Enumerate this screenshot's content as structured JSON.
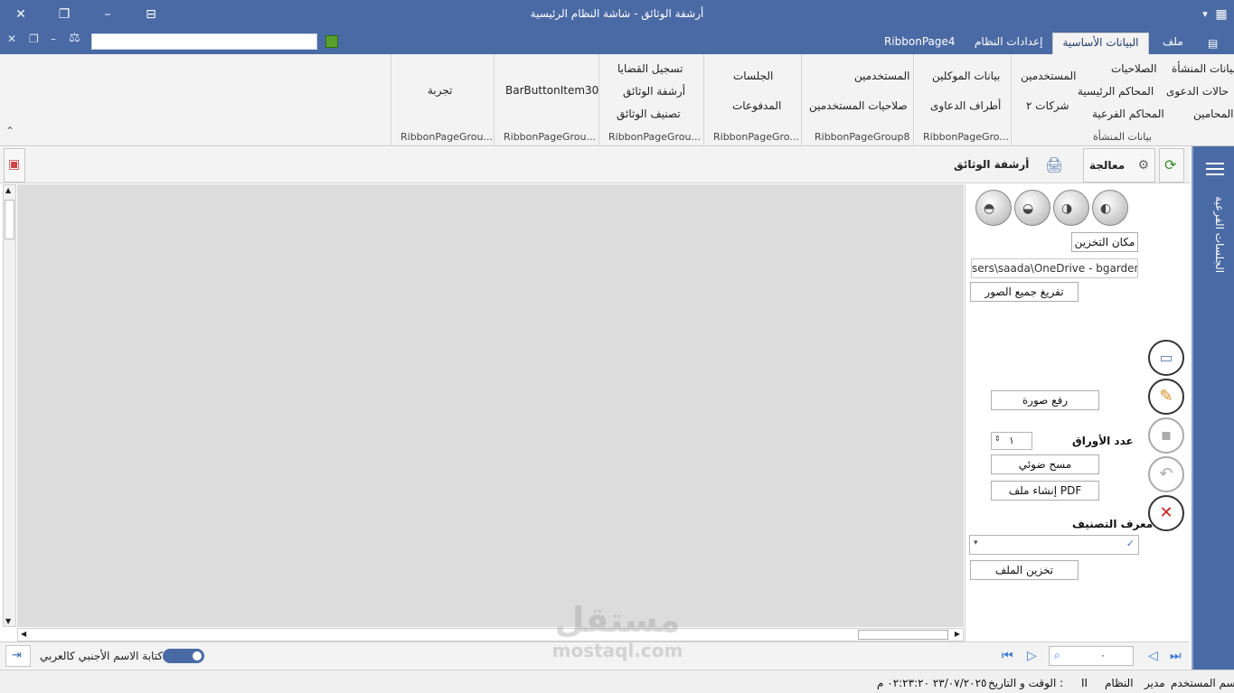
{
  "window": {
    "title": "أرشفة الوثائق - شاشة النظام الرئيسية"
  },
  "tabs": [
    {
      "label": "ملف"
    },
    {
      "label": "البيانات الأساسية"
    },
    {
      "label": "إعدادات النظام"
    },
    {
      "label": "RibbonPage4"
    }
  ],
  "ribbon": {
    "group1": {
      "items": [
        "بيانات المنشأة",
        "الصلاحيات",
        "المستخدمين",
        "حالات الدعوى",
        "المحاكم الرئيسية",
        "شركات ٢",
        "المحامين",
        "المحاكم الفرعية"
      ],
      "name": "بيانات المنشأة"
    },
    "group2": {
      "items": [
        "بيانات الموكلين",
        "أطراف الدعاوى"
      ],
      "name": "RibbonPageGro..."
    },
    "group3": {
      "items": [
        "المستخدمين",
        "صلاحيات المستخدمين"
      ],
      "name": "RibbonPageGroup8"
    },
    "group4": {
      "items": [
        "الجلسات",
        "المدفوعات"
      ],
      "name": "RibbonPageGro..."
    },
    "group5": {
      "items": [
        "تسجيل القضايا",
        "أرشفة الوثائق",
        "تصنيف الوثائق"
      ],
      "name": "RibbonPageGrou..."
    },
    "group6": {
      "items": [
        "BarButtonItem30"
      ],
      "name": "RibbonPageGrou..."
    },
    "group7": {
      "items": [
        "تجربة"
      ],
      "name": "RibbonPageGrou..."
    }
  },
  "side": {
    "label": "الجلسات الفرعية"
  },
  "toolbar": {
    "treat": "معالجة",
    "archive": "أرشفة الوثائق"
  },
  "panel": {
    "storage_location": "مكان التخزين",
    "path": "sers\\saada\\OneDrive - bgardens",
    "clear_all": "تفريغ جميع الصور",
    "upload_image": "رفع صورة",
    "sheet_count_label": "عدد الأوراق",
    "sheet_count": "١",
    "scan": "مسح ضوئي",
    "create_pdf": "إنشاء ملف PDF",
    "classification_id": "معرف التصنيف",
    "store_file": "تخزين الملف"
  },
  "bottom": {
    "toggle_label": "كتابة الاسم الأجنبي كالعربي",
    "page_value": "٠"
  },
  "status": {
    "user_label": "اسم المستخدم:",
    "user_value": "مدير",
    "system_label": "النظام",
    "sep": "II",
    "datetime_label": "الوقت و التاريخ :",
    "datetime_value": "٢٣/٠٧/٢٠٢٥ ٠٢:٢٣:٢٠ م"
  },
  "watermark": {
    "line1": "مستقل",
    "line2": "mostaql.com"
  }
}
